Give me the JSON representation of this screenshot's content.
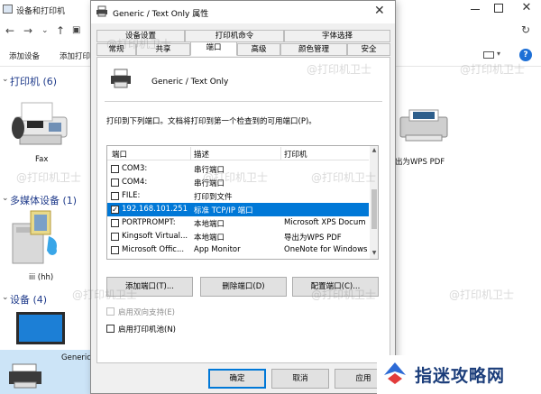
{
  "bg_window": {
    "title": "设备和打印机",
    "toolbar": {
      "add_device": "添加设备",
      "add_printer": "添加打印"
    },
    "sections": [
      {
        "label": "打印机 (6)"
      },
      {
        "label": "多媒体设备 (1)"
      },
      {
        "label": "设备 (4)"
      }
    ],
    "devices": {
      "fax": "Fax",
      "media": "iii (hh)",
      "generic": "Generic",
      "wps_pdf": "出为WPS PDF"
    }
  },
  "dialog": {
    "title": "Generic / Text Only 属性",
    "tabs_row1": [
      "设备设置",
      "打印机命令",
      "字体选择"
    ],
    "tabs_row2": [
      "常规",
      "共享",
      "端口",
      "高级",
      "颜色管理",
      "安全"
    ],
    "active_tab": "端口",
    "printer_name": "Generic / Text Only",
    "instruction": "打印到下列端口。文档将打印到第一个检查到的可用端口(P)。",
    "columns": [
      "端口",
      "描述",
      "打印机"
    ],
    "ports": [
      {
        "port": "COM3:",
        "desc": "串行端口",
        "printer": "",
        "checked": false,
        "selected": false
      },
      {
        "port": "COM4:",
        "desc": "串行端口",
        "printer": "",
        "checked": false,
        "selected": false
      },
      {
        "port": "FILE:",
        "desc": "打印到文件",
        "printer": "",
        "checked": false,
        "selected": false
      },
      {
        "port": "192.168.101.251",
        "desc": "标准 TCP/IP 端口",
        "printer": "",
        "checked": true,
        "selected": true
      },
      {
        "port": "PORTPROMPT:",
        "desc": "本地端口",
        "printer": "Microsoft XPS Docum",
        "checked": false,
        "selected": false
      },
      {
        "port": "Kingsoft Virtual...",
        "desc": "本地端口",
        "printer": "导出为WPS PDF",
        "checked": false,
        "selected": false
      },
      {
        "port": "Microsoft Offic...",
        "desc": "App Monitor",
        "printer": "OneNote for Windows",
        "checked": false,
        "selected": false
      }
    ],
    "buttons": {
      "add_port": "添加端口(T)...",
      "delete_port": "删除端口(D)",
      "configure_port": "配置端口(C)...",
      "ok": "确定",
      "cancel": "取消",
      "apply": "应用"
    },
    "options": {
      "bidirectional": "启用双向支持(E)",
      "pooling": "启用打印机池(N)"
    }
  },
  "watermark": "@打印机卫士",
  "logo": {
    "text": "指迷攻略网"
  },
  "colors": {
    "selection": "#0078d7",
    "section_header": "#1e3a8a",
    "logo_text": "#1b3d7a",
    "logo_mark": "#2d6bd6"
  }
}
